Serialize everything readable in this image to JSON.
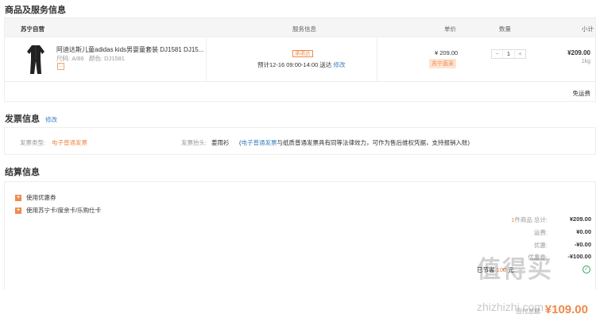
{
  "product_section": {
    "title": "商品及服务信息",
    "headers": {
      "store": "苏宁自营",
      "service": "服务信息",
      "price": "单价",
      "qty": "数量",
      "subtotal": "小计"
    },
    "item": {
      "name": "阿迪达斯儿童adidas kids男婴童套装 DJ1581 DJ15...",
      "size_label": "尺码:",
      "size": "A/86",
      "color_label": "颜色:",
      "color": "DJ1581",
      "service_tag": "承诺达",
      "delivery_time": "预计12-16 09:00-14:00 送达",
      "edit": "修改",
      "price": "¥ 209.00",
      "price_badge": "苏宁直采",
      "qty_minus": "−",
      "qty": "1",
      "qty_plus": "+",
      "subtotal": "¥209.00",
      "weight": "1kg"
    },
    "shipping": "免运费"
  },
  "invoice_section": {
    "title": "发票信息",
    "edit": "修改",
    "type_label": "发票类型:",
    "type_value": "电子普通发票",
    "header_label": "发票抬头:",
    "header_value": "姜雨衫",
    "note_link": "电子普通发票",
    "note_text": "与纸质普通发票具有同等法律效力，可作为售后维权凭据，支持报销入账)",
    "note_open": "("
  },
  "settlement_section": {
    "title": "结算信息",
    "options": [
      "使用优惠券",
      "使用苏宁卡/度余卡/乐购仕卡"
    ],
    "summary": [
      {
        "count": "1",
        "label": "件商品 总计:",
        "value": "¥209.00"
      },
      {
        "label": "运费:",
        "value": "¥0.00"
      },
      {
        "label": "优惠:",
        "value": "-¥0.00"
      },
      {
        "label": "优惠券:",
        "value": "-¥100.00"
      }
    ],
    "promo": {
      "prefix": "已节省",
      "amount": "100",
      "suffix": "元"
    },
    "total_label": "应付总额:",
    "total_value": "¥109.00"
  },
  "watermark": {
    "text": "值得买",
    "url": "zhizhizhi.com"
  },
  "colors": {
    "accent": "#f08a4b",
    "link": "#3b82c4",
    "border": "#eeeeee"
  }
}
